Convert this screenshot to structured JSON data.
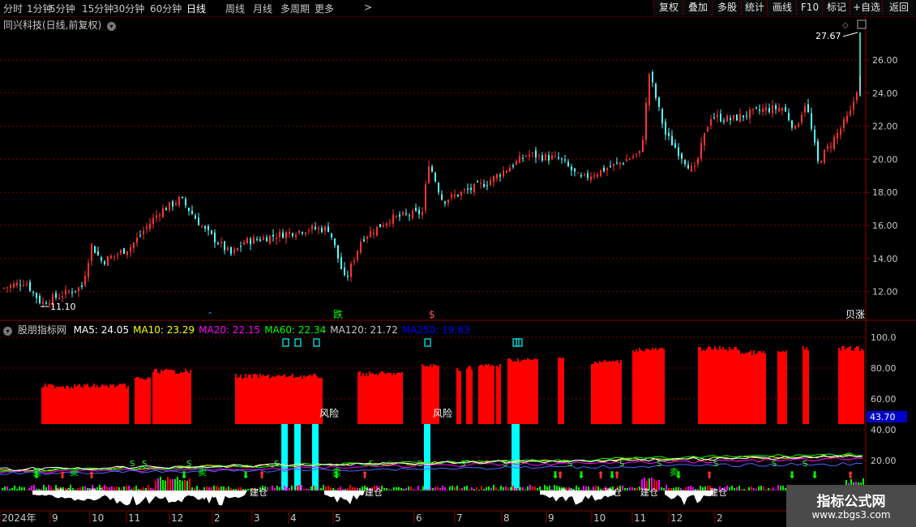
{
  "toolbar": {
    "periods": [
      "分时",
      "1分钟",
      "5分钟",
      "15分钟",
      "30分钟",
      "60分钟",
      "日线",
      "周线",
      "月线",
      "多周期",
      "更多"
    ],
    "active_period": "日线",
    "more_arrow": ">",
    "buttons": [
      "复权",
      "叠加",
      "多股",
      "统计",
      "画线",
      "F10",
      "标记",
      "+自选",
      "返回"
    ]
  },
  "main_panel": {
    "title": "同兴科技(日线,前复权)",
    "y_ticks": [
      "26.00",
      "24.00",
      "22.00",
      "20.00",
      "18.00",
      "16.00",
      "14.00",
      "12.00"
    ],
    "high_label": "27.67",
    "low_label": "11.10",
    "signal_labels": [
      "跌",
      "$",
      "贝涨"
    ]
  },
  "indicator_panel": {
    "name": "股朋指标网",
    "ma": [
      {
        "label": "MA5: 24.05",
        "color": "#ffffff"
      },
      {
        "label": "MA10: 23.29",
        "color": "#ffff00"
      },
      {
        "label": "MA20: 22.15",
        "color": "#ff00ff"
      },
      {
        "label": "MA60: 22.34",
        "color": "#00ff00"
      },
      {
        "label": "MA120: 21.72",
        "color": "#c8c8c8"
      },
      {
        "label": "MA250: 19.83",
        "color": "#0000ff"
      }
    ],
    "y_ticks": [
      "100.0",
      "80.00",
      "60.00",
      "40.00",
      "20.00"
    ],
    "current_value": "43.70",
    "risk_labels": [
      "风险",
      "风险"
    ],
    "buy_label": "建仓",
    "sell_label": "卖",
    "s_label": "S"
  },
  "time_axis": {
    "labels": [
      "2024年",
      "9",
      "10",
      "11",
      "12",
      "2",
      "3",
      "4",
      "5",
      "6",
      "7",
      "8",
      "9",
      "10",
      "11",
      "12",
      "2"
    ]
  },
  "watermark": {
    "line1": "指标公式网",
    "line2": "www.zbgs3.com"
  },
  "colors": {
    "up": "#ff3232",
    "down": "#54ffff",
    "bar": "#ff0000",
    "cyan": "#00ffff",
    "green": "#00ff00",
    "grid": "#7a0000",
    "axis_text": "#c8c8c8"
  }
}
